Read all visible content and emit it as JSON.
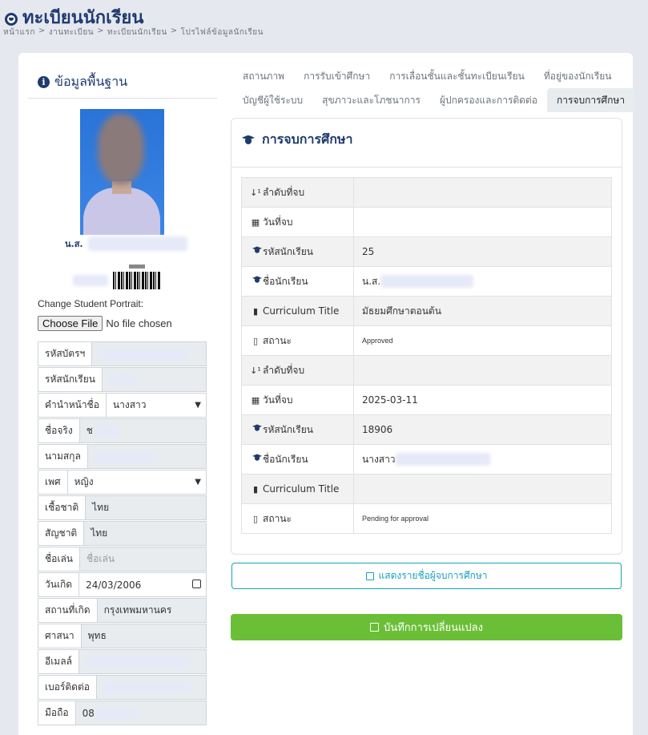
{
  "page": {
    "title": "ทะเบียนนักเรียน",
    "breadcrumb": [
      "หน้าแรก",
      "งานทะเบียน",
      "ทะเบียนนักเรียน",
      "โปรไฟล์ข้อมูลนักเรียน"
    ]
  },
  "left_panel": {
    "header": "ข้อมูลพื้นฐาน",
    "name_prefix": "น.ส.",
    "portrait_label": "Change Student Portrait:",
    "file_button": "Choose File",
    "file_status": "No file chosen",
    "fields": [
      {
        "label": "รหัสบัตรฯ",
        "value": "",
        "blurred": true
      },
      {
        "label": "รหัสนักเรียน",
        "value": "",
        "blurred": true
      },
      {
        "label": "คำนำหน้าชื่อ",
        "value": "นางสาว",
        "type": "select"
      },
      {
        "label": "ชื่อจริง",
        "value": "ช",
        "blurred": true
      },
      {
        "label": "นามสกุล",
        "value": "",
        "blurred": true
      },
      {
        "label": "เพศ",
        "value": "หญิง",
        "type": "select"
      },
      {
        "label": "เชื้อชาติ",
        "value": "ไทย"
      },
      {
        "label": "สัญชาติ",
        "value": "ไทย"
      },
      {
        "label": "ชื่อเล่น",
        "value": "",
        "placeholder": "ชื่อเล่น"
      },
      {
        "label": "วันเกิด",
        "value": "24/03/2006",
        "type": "date"
      },
      {
        "label": "สถานที่เกิด",
        "value": "กรุงเทพมหานคร"
      },
      {
        "label": "ศาสนา",
        "value": "พุทธ"
      },
      {
        "label": "อีเมลล์",
        "value": "",
        "blurred": true
      },
      {
        "label": "เบอร์ติดต่อ",
        "value": "",
        "blurred": true
      },
      {
        "label": "มือถือ",
        "value": "08",
        "blurred": true
      }
    ]
  },
  "tabs": {
    "row1": [
      "สถานภาพ",
      "การรับเข้าศึกษา",
      "การเลื่อนชั้นและชั้นทะเบียนเรียน",
      "ที่อยู่ของนักเรียน"
    ],
    "row2": [
      "บัญชีผู้ใช้ระบบ",
      "สุขภาวะและโภชนาการ",
      "ผู้ปกครองและการติดต่อ",
      "การจบการศึกษา"
    ],
    "active": "การจบการศึกษา"
  },
  "graduation": {
    "title": "การจบการศึกษา",
    "rows": [
      {
        "key": "ลำดับที่จบ",
        "icon": "sort-numeric-icon",
        "value": ""
      },
      {
        "key": "วันที่จบ",
        "icon": "calendar-icon",
        "value": ""
      },
      {
        "key": "รหัสนักเรียน",
        "icon": "graduation-cap-icon",
        "value": "25"
      },
      {
        "key": "ชื่อนักเรียน",
        "icon": "graduation-cap-icon",
        "value": "น.ส.",
        "blurred": true
      },
      {
        "key": "Curriculum Title",
        "icon": "book-icon",
        "value": "มัธยมศึกษาตอนต้น"
      },
      {
        "key": "สถานะ",
        "icon": "file-icon",
        "value": "Approved",
        "small": true
      },
      {
        "key": "ลำดับที่จบ",
        "icon": "sort-numeric-icon",
        "value": ""
      },
      {
        "key": "วันที่จบ",
        "icon": "calendar-icon",
        "value": "2025-03-11"
      },
      {
        "key": "รหัสนักเรียน",
        "icon": "graduation-cap-icon",
        "value": "18906"
      },
      {
        "key": "ชื่อนักเรียน",
        "icon": "graduation-cap-icon",
        "value": "นางสาว",
        "blurred": true
      },
      {
        "key": "Curriculum Title",
        "icon": "book-icon",
        "value": ""
      },
      {
        "key": "สถานะ",
        "icon": "file-icon",
        "value": "Pending for approval",
        "small": true
      }
    ]
  },
  "buttons": {
    "show_graduates": "แสดงรายชื่อผู้จบการศึกษา",
    "save": "บันทึกการเปลี่ยนแปลง"
  },
  "colors": {
    "primary": "#1f3a6e",
    "info": "#17a2b8",
    "success": "#6bbf37",
    "background": "#e6e8f0"
  }
}
